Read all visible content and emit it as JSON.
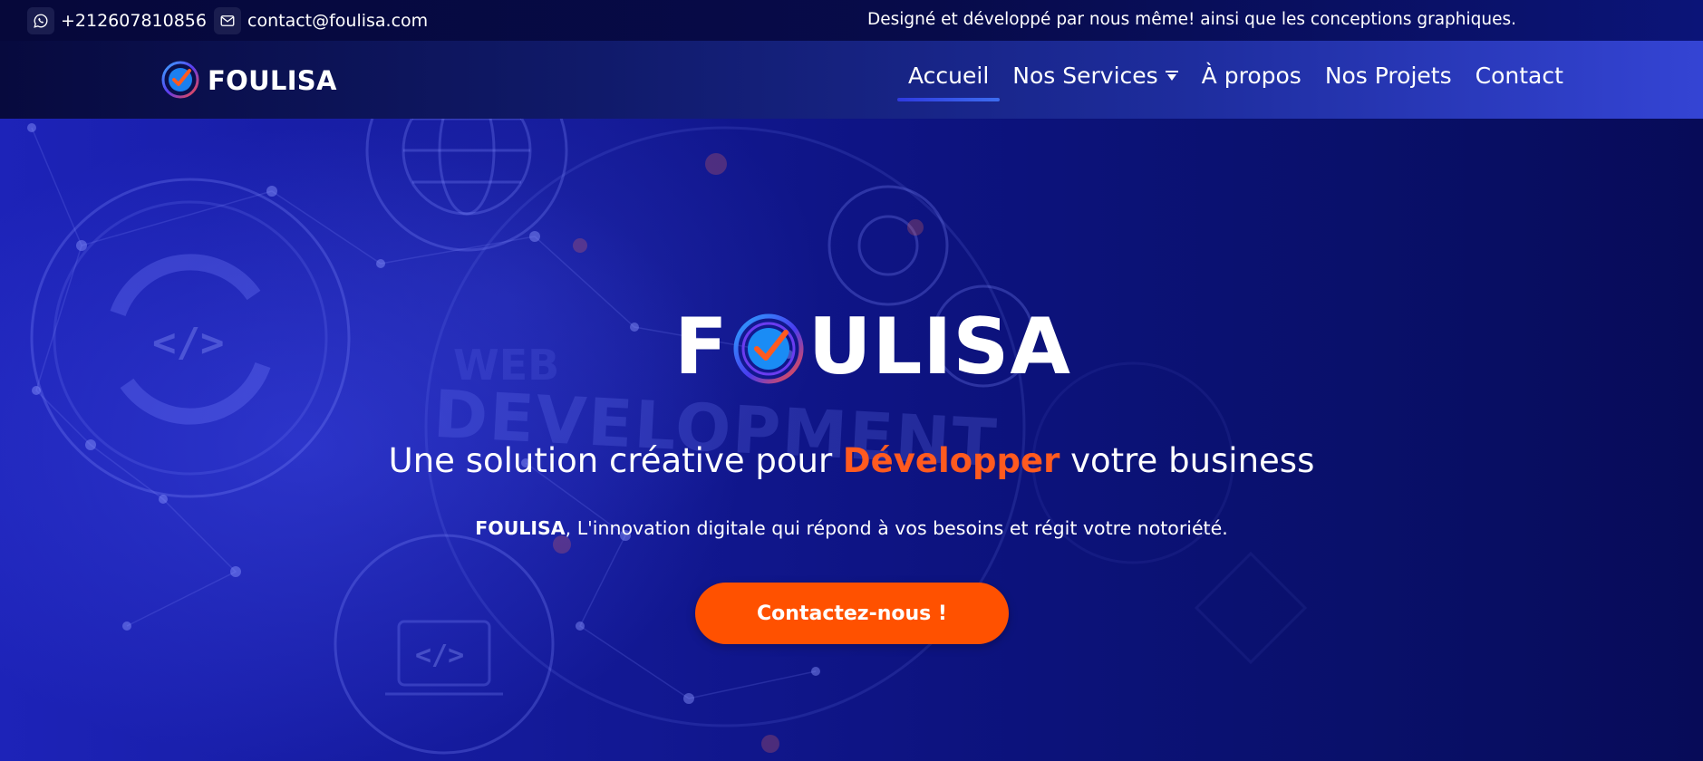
{
  "topbar": {
    "phone": "+212607810856",
    "email": "contact@foulisa.com",
    "tagline": "Designé et développé par nous même! ainsi que les conceptions graphiques."
  },
  "brand": {
    "name": "FOULISA"
  },
  "nav": {
    "items": [
      {
        "label": "Accueil",
        "active": true
      },
      {
        "label": "Nos Services",
        "has_dropdown": true
      },
      {
        "label": "À propos"
      },
      {
        "label": "Nos Projets"
      },
      {
        "label": "Contact"
      }
    ]
  },
  "hero": {
    "logo_left": "F",
    "logo_right": "ULISA",
    "background_text_1": "WEB",
    "background_text_2": "DEVELOPMENT",
    "headline_before": "Une solution créative pour ",
    "headline_accent": "Développer",
    "headline_after": " votre business",
    "subline_bold": "FOULISA",
    "subline_rest": ", L'innovation digitale qui répond à vos besoins et régit votre notoriété.",
    "cta_label": "Contactez-nous !"
  },
  "colors": {
    "accent": "#ff5100",
    "headline_accent": "#ff5a1f",
    "nav_underline": "#2f3ae0"
  }
}
